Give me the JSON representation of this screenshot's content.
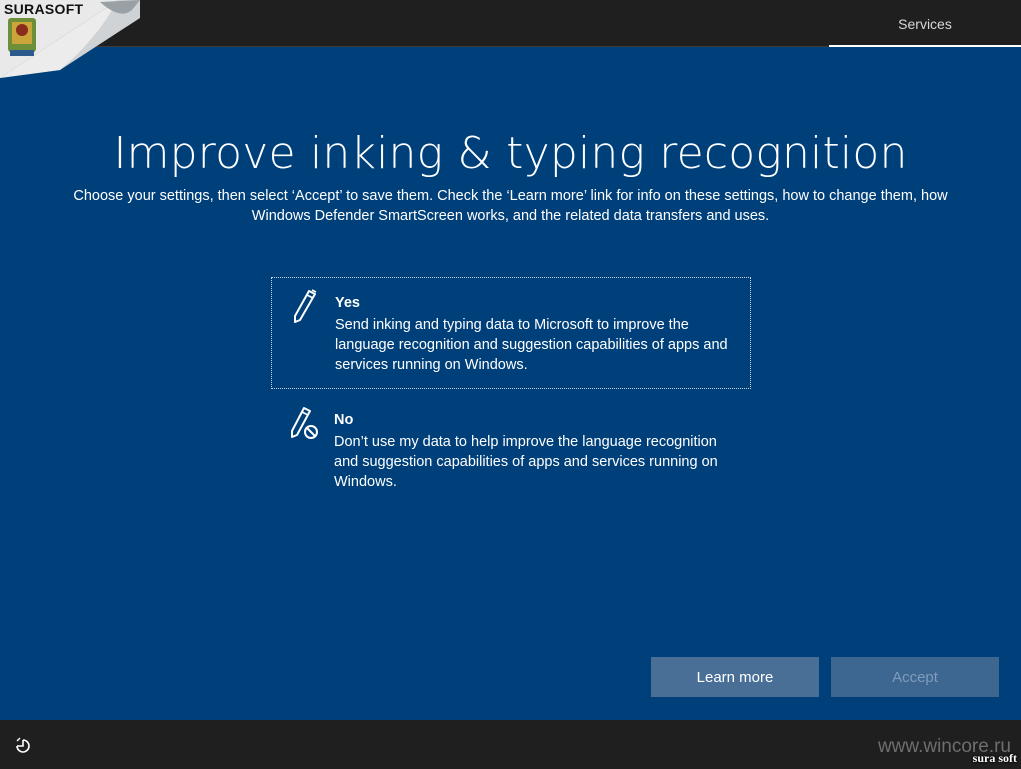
{
  "header": {
    "brand": "SURASOFT",
    "tab_label": "Services"
  },
  "main": {
    "title": "Improve inking & typing recognition",
    "subtitle": "Choose your settings, then select ‘Accept’ to save them. Check the ‘Learn more’ link for info on these settings, how to change them, how Windows Defender SmartScreen works, and the related data transfers and uses.",
    "options": [
      {
        "icon": "pen-icon",
        "label": "Yes",
        "description": "Send inking and typing data to Microsoft to improve the language recognition and suggestion capabilities of apps and services running on Windows.",
        "selected": true
      },
      {
        "icon": "pen-blocked-icon",
        "label": "No",
        "description": "Don’t use my data to help improve the language recognition and suggestion capabilities of apps and services running on Windows.",
        "selected": false
      }
    ]
  },
  "buttons": {
    "learn_more": "Learn more",
    "accept": "Accept"
  },
  "footer": {
    "watermark": "www.wincore.ru",
    "watermark_brand": "sura soft"
  },
  "colors": {
    "background": "#00407a",
    "bar": "#1f1f1f",
    "button": "#4a6f96",
    "button_disabled_text": "#7f9cbd"
  }
}
